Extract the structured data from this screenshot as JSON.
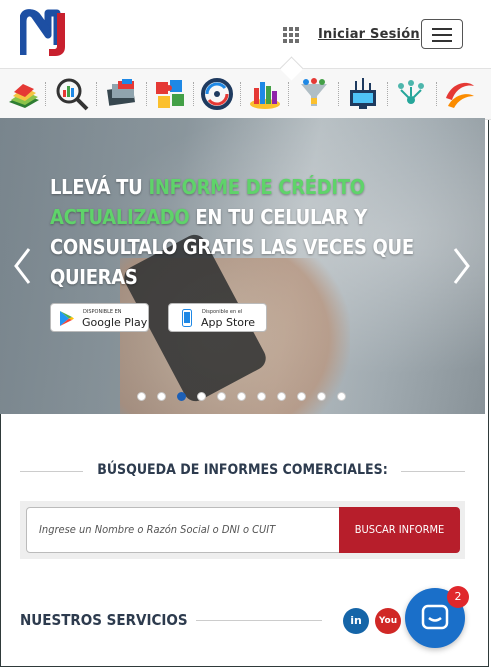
{
  "colors": {
    "brand_blue": "#1d4fa3",
    "brand_red": "#c8202e",
    "highlight_green": "#5fd36a",
    "search_button": "#b71e2b",
    "chat": "#1a6fc9"
  },
  "nav": {
    "logo_icon": "nj-logo-icon",
    "apps_icon": "grid-icon",
    "login_label": "Iniciar Sesión",
    "menu_icon": "hamburger-icon"
  },
  "services_icons": [
    "book-icon",
    "magnifier-chart-icon",
    "document-stack-icon",
    "puzzle-icon",
    "refresh-circle-icon",
    "city-chart-icon",
    "funnel-people-icon",
    "monitor-icon",
    "people-network-icon",
    "ribbon-icon"
  ],
  "hero": {
    "line1_white": "LLEVÁ TU ",
    "line1_green": "INFORME DE CRÉDITO",
    "line2_green": "ACTUALIZADO",
    "line2_white": " EN TU CELULAR Y",
    "line3": "CONSULTALO GRATIS LAS VECES QUE",
    "line4": "QUIERAS",
    "google_small": "DISPONIBLE EN",
    "google_big": "Google Play",
    "apple_small": "Disponible en el",
    "apple_big": "App Store",
    "slide_count": 11,
    "active_slide": 3
  },
  "search": {
    "title": "BÚSQUEDA DE INFORMES COMERCIALES:",
    "placeholder": "Ingrese un Nombre o Razón Social o DNI o CUIT",
    "button_label": "BUSCAR INFORME"
  },
  "services": {
    "title": "NUESTROS SERVICIOS",
    "linkedin_label": "in",
    "youtube_label": "You"
  },
  "chat": {
    "badge_count": "2"
  }
}
